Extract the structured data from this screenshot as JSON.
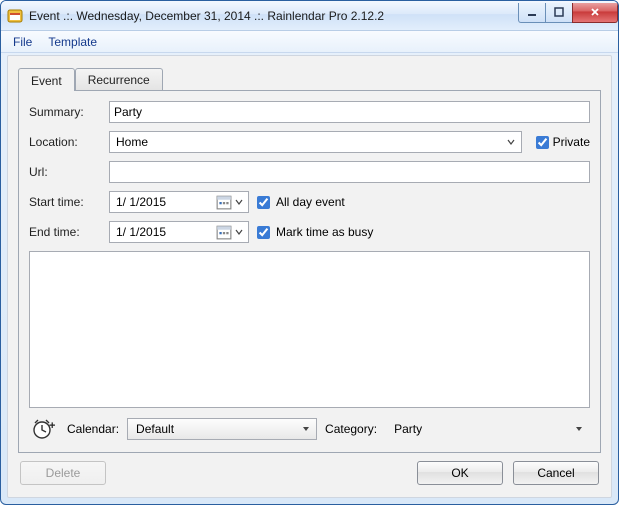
{
  "window": {
    "title": "Event .:. Wednesday, December 31, 2014 .:. Rainlendar Pro 2.12.2"
  },
  "menu": {
    "file": "File",
    "template": "Template"
  },
  "tabs": {
    "event": "Event",
    "recurrence": "Recurrence"
  },
  "labels": {
    "summary": "Summary:",
    "location": "Location:",
    "private": "Private",
    "url": "Url:",
    "start_time": "Start time:",
    "end_time": "End time:",
    "all_day": "All day event",
    "mark_busy": "Mark time as busy",
    "calendar": "Calendar:",
    "category": "Category:"
  },
  "values": {
    "summary": "Party",
    "location": "Home",
    "url": "",
    "start_date": "1/  1/2015",
    "end_date": "1/  1/2015",
    "private_checked": true,
    "all_day_checked": true,
    "mark_busy_checked": true,
    "description": "",
    "calendar": "Default",
    "category": "Party"
  },
  "buttons": {
    "delete": "Delete",
    "ok": "OK",
    "cancel": "Cancel"
  }
}
